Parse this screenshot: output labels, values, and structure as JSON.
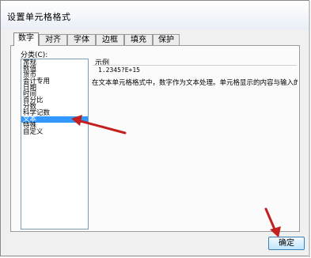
{
  "dialog": {
    "title": "设置单元格格式"
  },
  "tabs": [
    {
      "label": "数字"
    },
    {
      "label": "对齐"
    },
    {
      "label": "字体"
    },
    {
      "label": "边框"
    },
    {
      "label": "填充"
    },
    {
      "label": "保护"
    }
  ],
  "category": {
    "label": "分类(C):",
    "items": [
      "常规",
      "数值",
      "货币",
      "会计专用",
      "日期",
      "时间",
      "百分比",
      "分数",
      "科学记数",
      "文本",
      "特殊",
      "自定义"
    ],
    "selected": "文本"
  },
  "sample": {
    "label": "示例",
    "value": "1.2345?E+15"
  },
  "description": "在文本单元格格式中，数字作为文本处理。单元格显示的内容与输入的内容",
  "buttons": {
    "ok": "确定"
  },
  "colors": {
    "selection": "#3399ff",
    "arrow": "#c42020"
  }
}
